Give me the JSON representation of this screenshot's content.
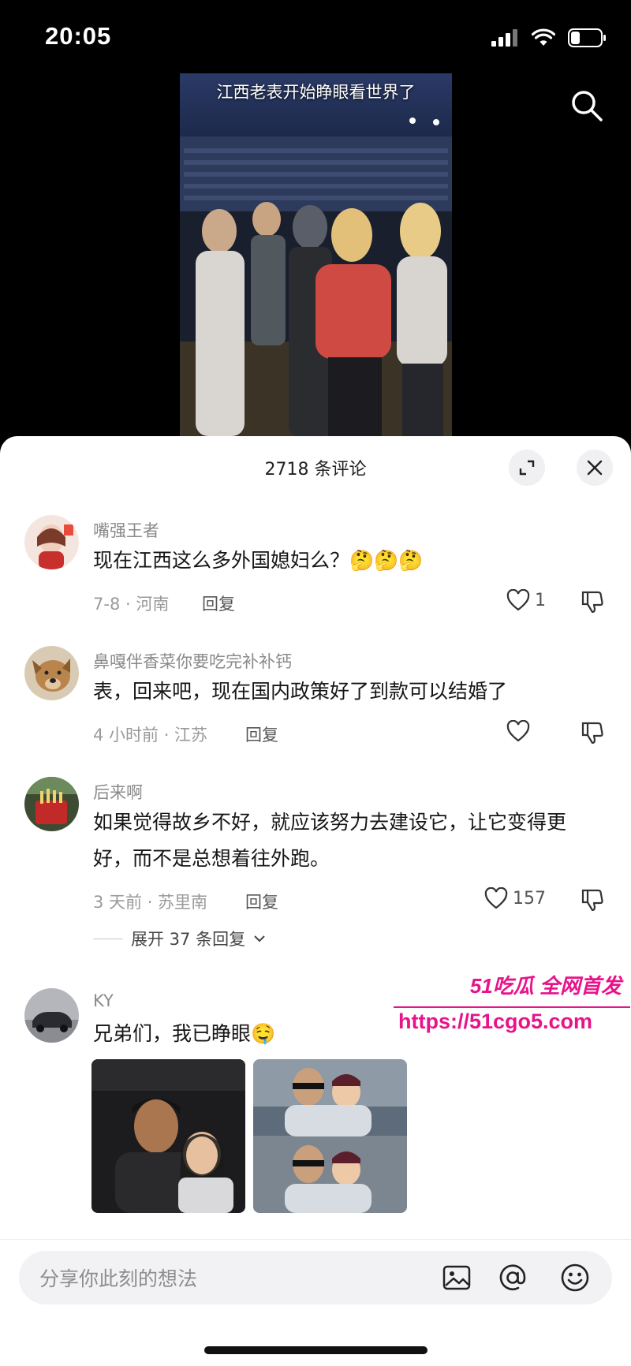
{
  "status": {
    "time": "20:05"
  },
  "video": {
    "caption": "江西老表开始睁眼看世界了"
  },
  "comments_sheet": {
    "title": "2718 条评论"
  },
  "comments": [
    {
      "user": "嘴强王者",
      "text": "现在江西这么多外国媳妇么？🤔🤔🤔",
      "meta": "7-8 · 河南",
      "reply_label": "回复",
      "likes": "1"
    },
    {
      "user": "鼻嘎伴香菜你要吃完补补钙",
      "text": "表，回来吧，现在国内政策好了到款可以结婚了",
      "meta": "4 小时前 · 江苏",
      "reply_label": "回复",
      "likes": ""
    },
    {
      "user": "后来啊",
      "text": "如果觉得故乡不好，就应该努力去建设它，让它变得更好，而不是总想着往外跑。",
      "meta": "3 天前 · 苏里南",
      "reply_label": "回复",
      "likes": "157",
      "expand_replies": "展开 37 条回复"
    },
    {
      "user": "KY",
      "text": "兄弟们，我已睁眼🤤"
    }
  ],
  "watermark": {
    "line1": "51吃瓜 全网首发",
    "url": "https://51cgo5.com"
  },
  "composer": {
    "placeholder": "分享你此刻的想法"
  },
  "icons": {
    "search": "search-icon",
    "expand": "expand-icon",
    "close": "close-icon",
    "like": "heart-icon",
    "dislike": "thumbs-down-icon",
    "image": "image-icon",
    "mention": "at-icon",
    "emoji": "emoji-icon"
  },
  "colors": {
    "accent_watermark": "#e8138a",
    "sheet_bg": "#ffffff",
    "pill_bg": "#f2f2f4"
  }
}
